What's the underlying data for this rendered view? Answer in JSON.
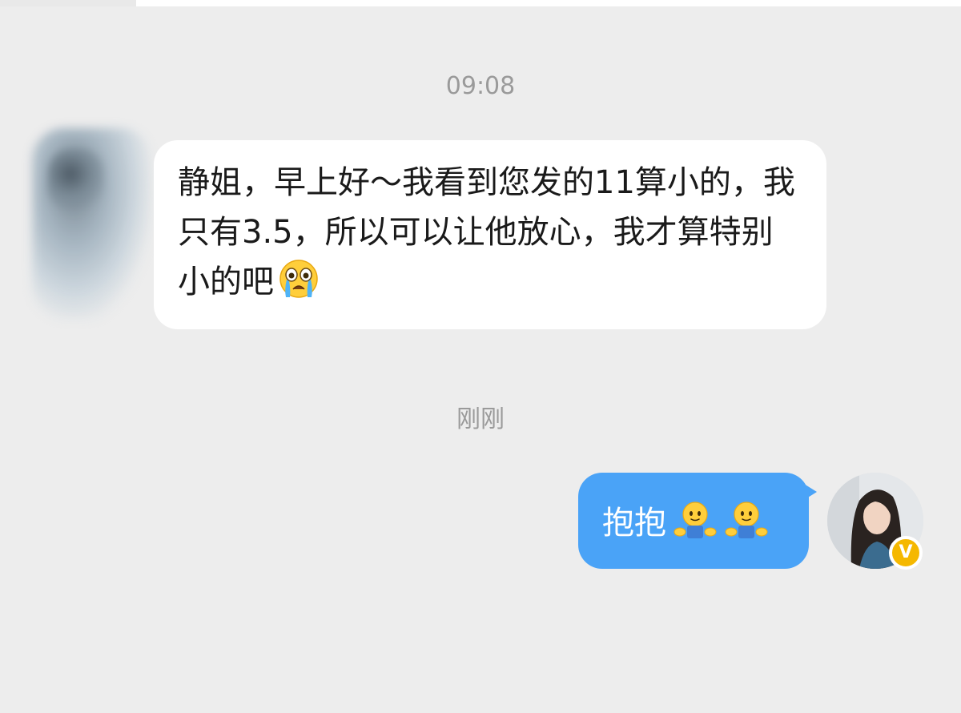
{
  "chat": {
    "messages": [
      {
        "timestamp": "09:08",
        "sender": "other",
        "text": "静姐，早上好～我看到您发的11算小的，我只有3.5，所以可以让他放心，我才算特别小的吧",
        "emoji": "loudly-crying-face"
      },
      {
        "timestamp": "刚刚",
        "sender": "self",
        "text": "抱抱",
        "emoji": "hugging-face",
        "emoji_count": 2
      }
    ],
    "self_avatar": {
      "badge": "V",
      "badge_color": "#f5b800"
    }
  },
  "colors": {
    "background": "#ededed",
    "incoming_bubble": "#ffffff",
    "outgoing_bubble": "#4aa3f7",
    "timestamp_text": "#9a9a9a"
  }
}
